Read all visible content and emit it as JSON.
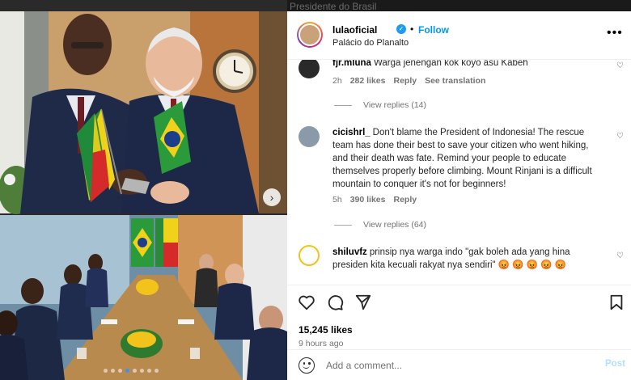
{
  "top_strip": {
    "cut_text": "Presidente do Brasil"
  },
  "photo": {
    "nav_arrow": "›",
    "dots": [
      false,
      false,
      false,
      true,
      false,
      false,
      false,
      false
    ]
  },
  "post": {
    "username": "lulaoficial",
    "verified_mark": "✓",
    "bullet": "•",
    "follow_label": "Follow",
    "location": "Palácio do Planalto",
    "more_label": "•••"
  },
  "comments": [
    {
      "username": "fjr.mluna",
      "text": "Warga jenengan kok koyo asu Kabeh",
      "time": "2h",
      "likes": "282 likes",
      "reply": "Reply",
      "translate": "See translation",
      "view_replies": "View replies (14)"
    },
    {
      "username": "cicishrl_",
      "text": "Don't blame the President of Indonesia! The rescue team has done their best to save your citizen who went hiking, and their death was fate. Remind your people to educate themselves properly before climbing. Mount Rinjani is a difficult mountain to conquer it's not for beginners!",
      "time": "5h",
      "likes": "390 likes",
      "reply": "Reply",
      "view_replies": "View replies (64)"
    },
    {
      "username": "shiluvfz",
      "text": "prinsip nya warga indo \"gak boleh ada yang hina presiden kita kecuali rakyat nya sendiri\" 😡 😡 😡 😡 😡"
    }
  ],
  "heart_icon": "♡",
  "engagement": {
    "likes": "15,245 likes",
    "time_ago": "9 hours ago"
  },
  "add_comment": {
    "placeholder": "Add a comment...",
    "post_label": "Post"
  }
}
